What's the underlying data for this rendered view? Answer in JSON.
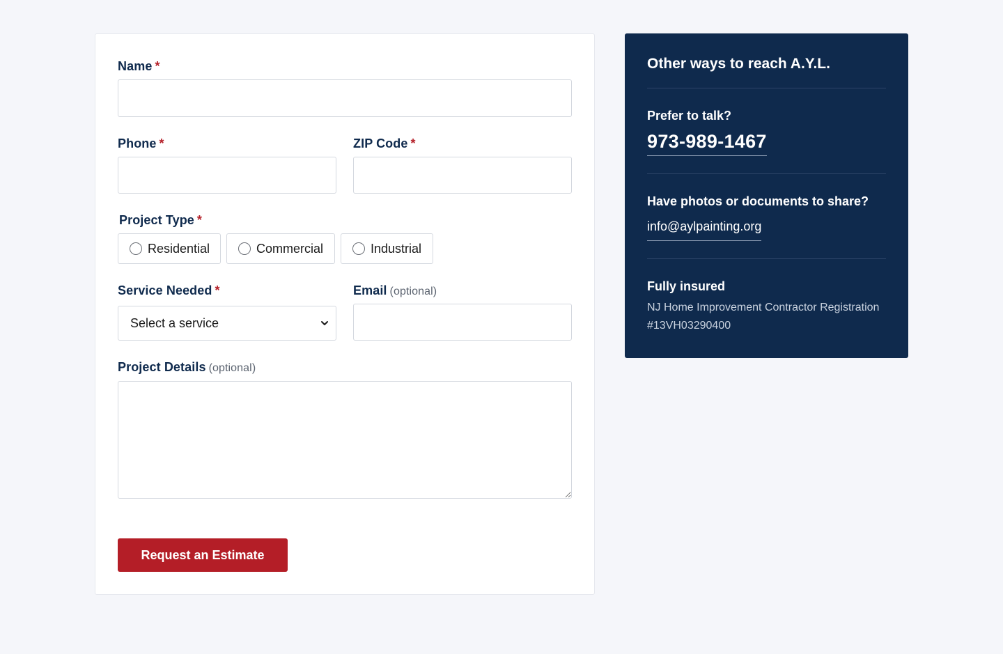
{
  "form": {
    "name": {
      "label": "Name",
      "required_mark": "*",
      "value": ""
    },
    "phone": {
      "label": "Phone",
      "required_mark": "*",
      "value": ""
    },
    "zip": {
      "label": "ZIP Code",
      "required_mark": "*",
      "value": ""
    },
    "project_type": {
      "label": "Project Type",
      "required_mark": "*",
      "options": [
        "Residential",
        "Commercial",
        "Industrial"
      ],
      "selected": null
    },
    "service": {
      "label": "Service Needed",
      "required_mark": "*",
      "selected": "Select a service"
    },
    "email": {
      "label": "Email",
      "optional_note": "(optional)",
      "value": ""
    },
    "details": {
      "label": "Project Details",
      "optional_note": "(optional)",
      "value": ""
    },
    "submit_label": "Request an Estimate"
  },
  "sidebar": {
    "title": "Other ways to reach A.Y.L.",
    "talk_heading": "Prefer to talk?",
    "phone": "973-989-1467",
    "share_heading": "Have photos or documents to share?",
    "email": "info@aylpainting.org",
    "insured_heading": "Fully insured",
    "registration_line1": "NJ Home Improvement Contractor Registration",
    "registration_line2": "#13VH03290400"
  },
  "colors": {
    "navy": "#0f2a4d",
    "accent_red": "#b41e27",
    "page_bg": "#f5f6fa"
  }
}
